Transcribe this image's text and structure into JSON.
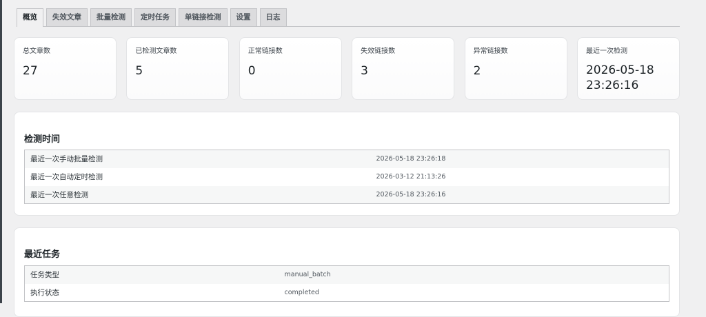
{
  "tabs": [
    {
      "label": "概览",
      "active": true
    },
    {
      "label": "失效文章",
      "active": false
    },
    {
      "label": "批量检测",
      "active": false
    },
    {
      "label": "定时任务",
      "active": false
    },
    {
      "label": "单链接检测",
      "active": false
    },
    {
      "label": "设置",
      "active": false
    },
    {
      "label": "日志",
      "active": false
    }
  ],
  "stats": [
    {
      "label": "总文章数",
      "value": "27"
    },
    {
      "label": "已检测文章数",
      "value": "5"
    },
    {
      "label": "正常链接数",
      "value": "0"
    },
    {
      "label": "失效链接数",
      "value": "3"
    },
    {
      "label": "异常链接数",
      "value": "2"
    },
    {
      "label": "最近一次检测",
      "value": "2026-05-18 23:26:16"
    }
  ],
  "check_times": {
    "title": "检测时间",
    "rows": [
      {
        "label": "最近一次手动批量检测",
        "value": "2026-05-18 23:26:18"
      },
      {
        "label": "最近一次自动定时检测",
        "value": "2026-03-12 21:13:26"
      },
      {
        "label": "最近一次任意检测",
        "value": "2026-05-18 23:26:16"
      }
    ]
  },
  "recent_task": {
    "title": "最近任务",
    "rows": [
      {
        "label": "任务类型",
        "value": "manual_batch"
      },
      {
        "label": "执行状态",
        "value": "completed"
      }
    ]
  }
}
